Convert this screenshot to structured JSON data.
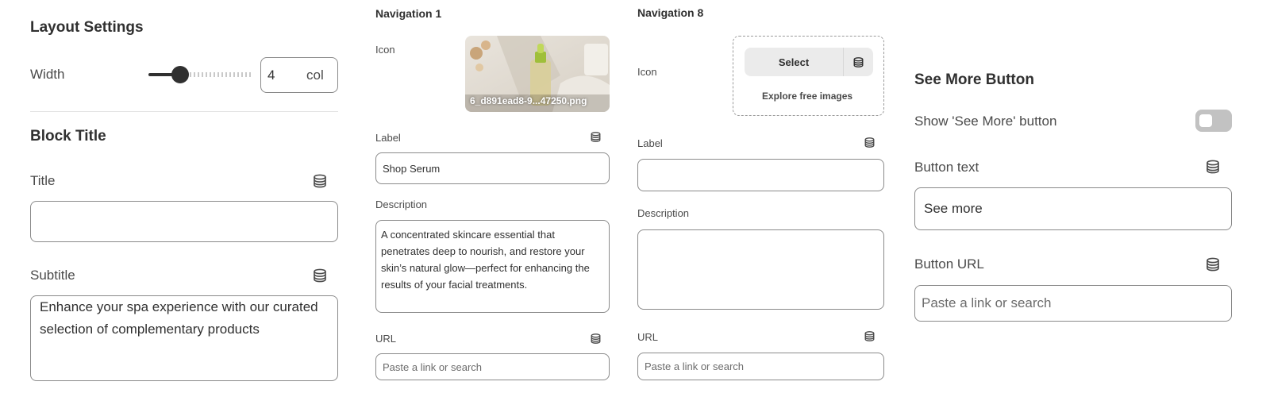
{
  "layout_settings": {
    "title": "Layout Settings",
    "width_label": "Width",
    "width_value": "4",
    "width_unit": "col",
    "slider_fraction": 0.31
  },
  "block_title": {
    "heading": "Block Title",
    "title_label": "Title",
    "title_value": "",
    "subtitle_label": "Subtitle",
    "subtitle_value": "Enhance your spa experience with our curated selection of complementary products"
  },
  "nav1": {
    "heading": "Navigation 1",
    "icon_label": "Icon",
    "image_caption": "6_d891ead8-9...47250.png",
    "label_label": "Label",
    "label_value": "Shop Serum",
    "description_label": "Description",
    "description_value": "A concentrated skincare essential that penetrates deep to nourish, and restore your skin’s natural glow—perfect for enhancing the results of your facial treatments.",
    "url_label": "URL",
    "url_placeholder": "Paste a link or search"
  },
  "nav8": {
    "heading": "Navigation 8",
    "icon_label": "Icon",
    "select_label": "Select",
    "explore_label": "Explore free images",
    "label_label": "Label",
    "label_value": "",
    "description_label": "Description",
    "description_value": "",
    "url_label": "URL",
    "url_placeholder": "Paste a link or search"
  },
  "see_more": {
    "heading": "See More Button",
    "toggle_label": "Show 'See More' button",
    "toggle_on": false,
    "button_text_label": "Button text",
    "button_text_value": "See more",
    "button_url_label": "Button URL",
    "button_url_placeholder": "Paste a link or search"
  },
  "icons": {
    "dynamic_source": "database-icon",
    "toggle": "toggle-off"
  },
  "colors": {
    "text": "#303030",
    "border": "#8a8a8a",
    "toggle_off": "#c2c2c2",
    "button_bg": "#ebebeb"
  }
}
